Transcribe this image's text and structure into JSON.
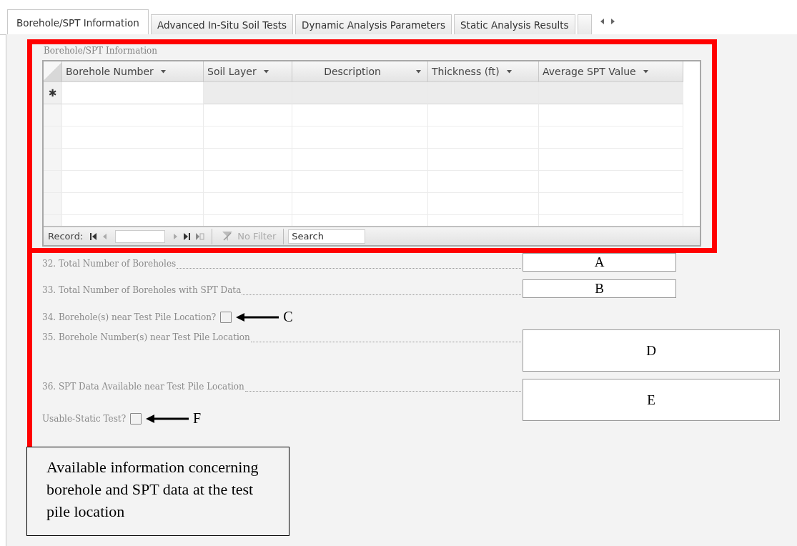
{
  "tabs": [
    {
      "label": "Borehole/SPT Information",
      "selected": true
    },
    {
      "label": "Advanced In-Situ Soil Tests",
      "selected": false
    },
    {
      "label": "Dynamic Analysis Parameters",
      "selected": false
    },
    {
      "label": "Static Analysis Results",
      "selected": false
    }
  ],
  "subform": {
    "title": "Borehole/SPT Information",
    "columns": [
      {
        "label": "Borehole Number"
      },
      {
        "label": "Soil Layer"
      },
      {
        "label": "Description"
      },
      {
        "label": "Thickness (ft)"
      },
      {
        "label": "Average SPT Value"
      }
    ],
    "new_row_marker": "✱",
    "navigation": {
      "record_label": "Record:",
      "filter": "No Filter",
      "search_placeholder": "Search"
    }
  },
  "fields": [
    {
      "kind": "text",
      "label": "32. Total Number of Boreholes",
      "value": "A"
    },
    {
      "kind": "text",
      "label": "33. Total Number of Boreholes with SPT Data",
      "value": "B"
    },
    {
      "kind": "checkbox",
      "label": "34. Borehole(s) near Test Pile Location?",
      "checked": false,
      "annotation": "C"
    },
    {
      "kind": "textarea",
      "label": "35. Borehole Number(s) near Test Pile Location",
      "value": "D"
    },
    {
      "kind": "textarea",
      "label": "36. SPT Data Available near Test Pile Location",
      "value": "E"
    },
    {
      "kind": "checkbox",
      "label": "Usable-Static Test?",
      "checked": false,
      "annotation": "F"
    }
  ],
  "callout": "Available information concerning borehole and SPT data at the test pile location"
}
